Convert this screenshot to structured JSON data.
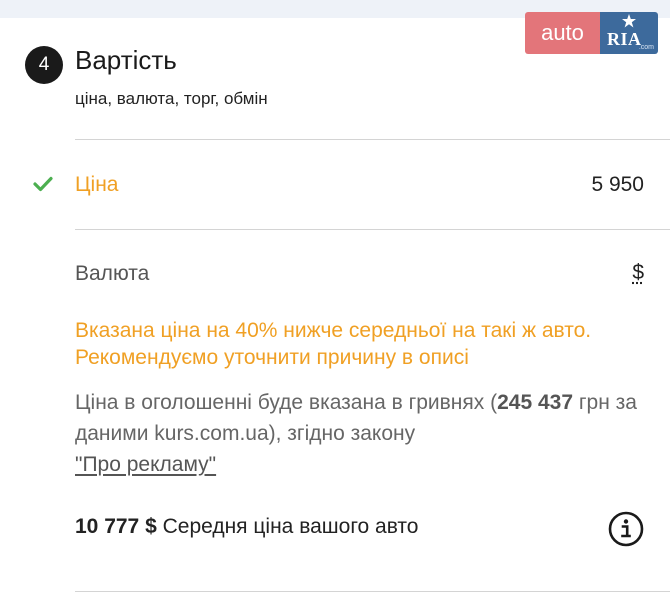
{
  "logo": {
    "auto": "auto",
    "ria": "RIA",
    "ria_sub": ".com"
  },
  "step": {
    "number": "4",
    "title": "Вартість",
    "subtitle": "ціна, валюта, торг, обмін"
  },
  "price": {
    "label": "Ціна",
    "value": "5 950",
    "status_icon": "check-icon"
  },
  "currency": {
    "label": "Валюта",
    "value": "$"
  },
  "warning": "Вказана ціна на 40% нижче середньої на такі ж авто. Рекомендуємо уточнити причину в описі",
  "conversion": {
    "prefix": "Ціна в оголошенні буде вказана в гривнях (",
    "amount": "245 437",
    "suffix": " грн за даними kurs.com.ua), згідно закону ",
    "law_link": "\"Про рекламу\""
  },
  "average": {
    "value": "10 777 $",
    "label": "Середня ціна вашого авто"
  },
  "colors": {
    "accent": "#f0a024",
    "check": "#4caf50",
    "logo_auto": "#e3757a",
    "logo_ria": "#3d6a9c"
  }
}
